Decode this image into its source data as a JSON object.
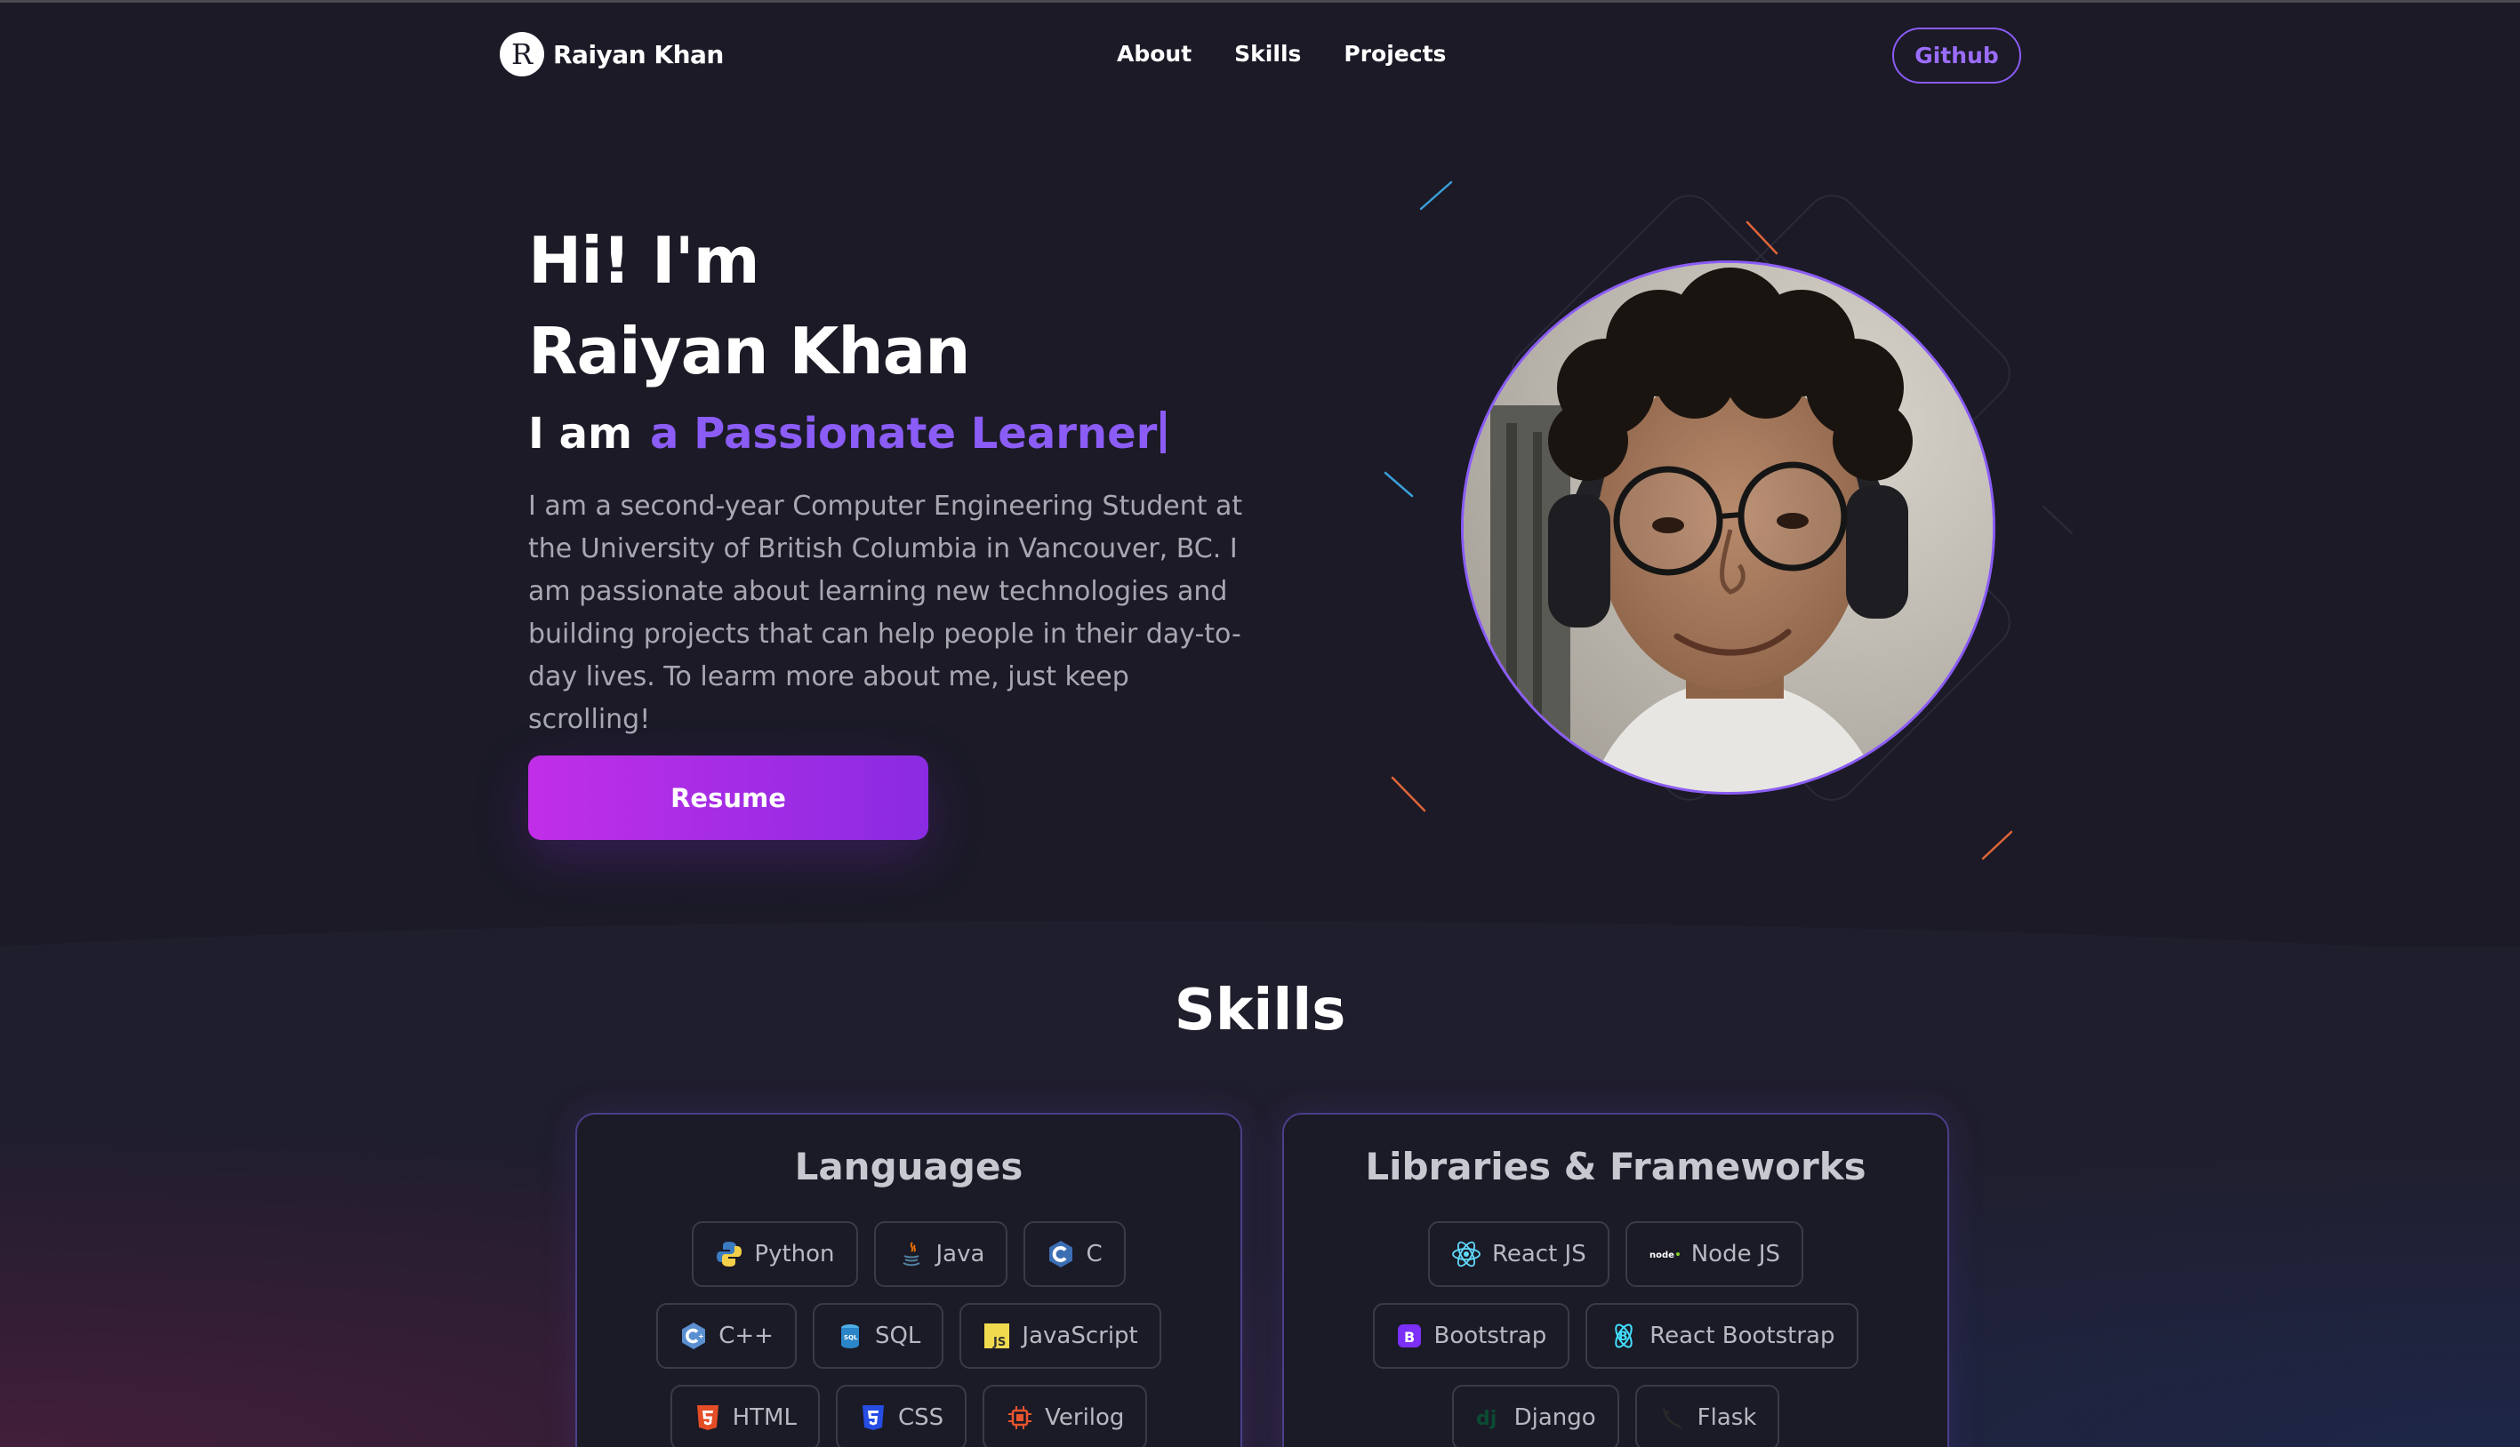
{
  "nav": {
    "logo_letter": "R",
    "brand": "Raiyan Khan",
    "links": [
      {
        "label": "About"
      },
      {
        "label": "Skills"
      },
      {
        "label": "Projects"
      }
    ],
    "github_label": "Github"
  },
  "hero": {
    "greeting": "Hi! I'm",
    "name": "Raiyan Khan",
    "role_prefix": "I am",
    "role_text": "a Passionate Learner",
    "description": "I am a second-year Computer Engineering Student at the University of British Columbia in Vancouver, BC. I am passionate about learning new technologies and building projects that can help people in their day-to-day lives. To learm more about me, just keep scrolling!",
    "resume_label": "Resume"
  },
  "skills": {
    "title": "Skills",
    "languages": {
      "title": "Languages",
      "items": [
        "Python",
        "Java",
        "C",
        "C++",
        "SQL",
        "JavaScript",
        "HTML",
        "CSS",
        "Verilog"
      ]
    },
    "libraries": {
      "title": "Libraries & Frameworks",
      "items": [
        "React JS",
        "Node JS",
        "Bootstrap",
        "React Bootstrap",
        "Django",
        "Flask"
      ]
    }
  },
  "colors": {
    "accent": "#8b5cf6",
    "background": "#1b1a26",
    "button_gradient_start": "#c12ee8",
    "button_gradient_end": "#8a2be2"
  }
}
